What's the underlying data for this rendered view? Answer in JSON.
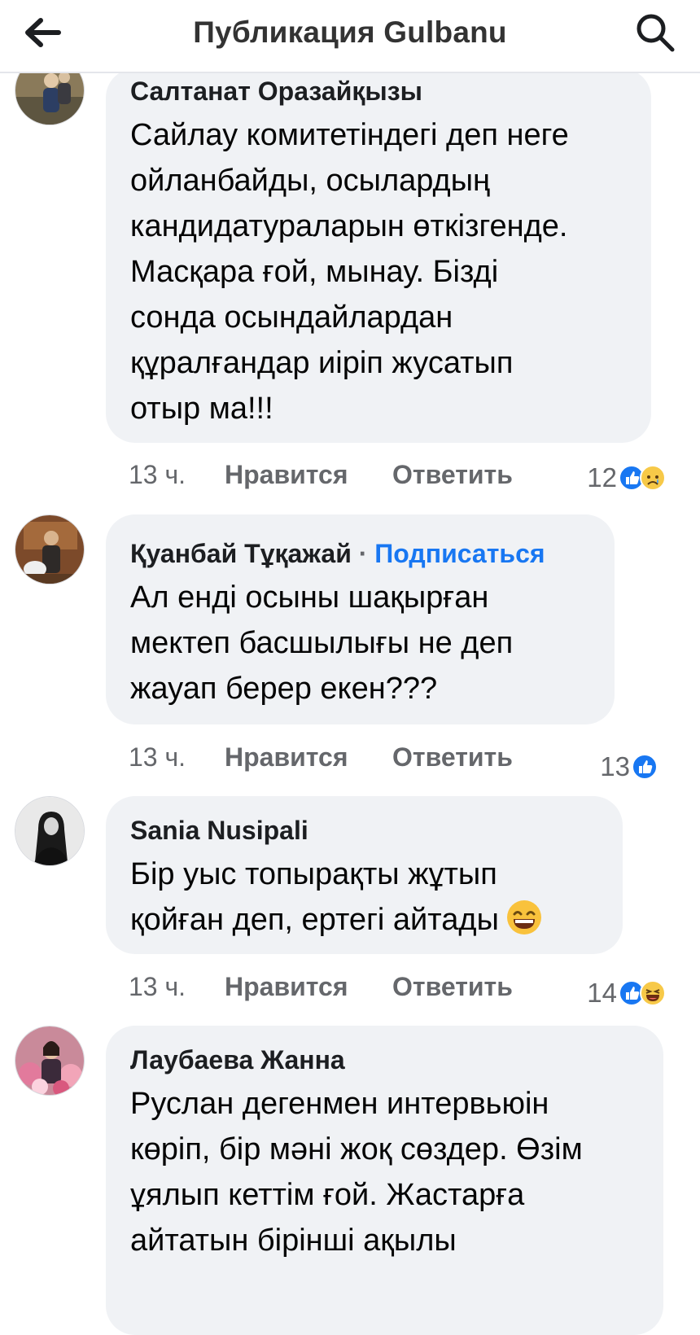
{
  "header": {
    "title": "Публикация Gulbanu",
    "back_icon": "arrow-left-icon",
    "search_icon": "search-icon"
  },
  "comments": [
    {
      "author": "Салтанат Оразайқызы",
      "lines": [
        "Сайлау комитетіндегі деп неге",
        "ойланбайды, осылардың",
        "кандидатураларын өткізгенде.",
        "Масқара ғой, мынау. Бізді",
        "сонда осындайлардан",
        "құралғандар иіріп жусатып",
        "отыр ма!!!"
      ],
      "time": "13 ч.",
      "like": "Нравится",
      "reply": "Ответить",
      "reaction_count": "12",
      "reactions": [
        "like-icon",
        "sad-icon"
      ]
    },
    {
      "author": "Қуанбай Тұқажай",
      "separator": "·",
      "follow": "Подписаться",
      "lines": [
        "Ал енді осыны шақырған",
        "мектеп басшылығы не деп",
        "жауап берер екен???"
      ],
      "time": "13 ч.",
      "like": "Нравится",
      "reply": "Ответить",
      "reaction_count": "13",
      "reactions": [
        "like-icon"
      ]
    },
    {
      "author": "Sania Nusipali",
      "lines": [
        "Бір уыс топырақты жұтып",
        "қойған деп, ертегі айтады"
      ],
      "inline_emoji": "grinning-face-icon",
      "time": "13 ч.",
      "like": "Нравится",
      "reply": "Ответить",
      "reaction_count": "14",
      "reactions": [
        "like-icon",
        "haha-icon"
      ]
    },
    {
      "author": "Лаубаева Жанна",
      "lines": [
        "Руслан дегенмен интервьюін",
        "көріп, бір мәні жоқ сөздер. Өзім",
        "ұялып кеттім ғой. Жастарға",
        "айтатын бірінші ақылы"
      ]
    }
  ],
  "colors": {
    "accent": "#1877f2",
    "bubble": "#f0f2f5",
    "meta": "#65676b"
  }
}
